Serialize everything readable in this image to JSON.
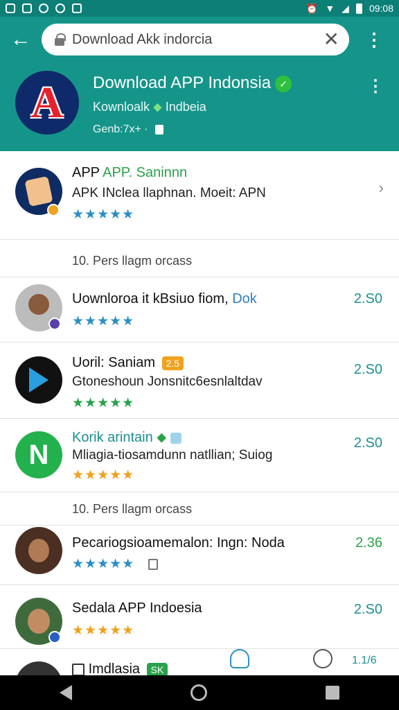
{
  "status_bar": {
    "time": "09:08"
  },
  "search": {
    "value": "Download Akk indorcia",
    "clear_glyph": "✕"
  },
  "header": {
    "title": "Download APP Indonsia",
    "verified_glyph": "✓",
    "subtitle": "Kownloalk",
    "subtitle_tag": "Indbeia",
    "meta": "Genb:7x+ ·",
    "logo_letter": "A"
  },
  "list": {
    "item1": {
      "title_a": "APP",
      "title_b": "APP. Saninnn",
      "sub": "APK INclea llaphnan. Moeit: APN",
      "stars": "★★★★★"
    },
    "section1": "10. Pers llagm orcass",
    "item2": {
      "title_a": "Uownloroa it kBsiuo fiom,",
      "title_b": "Dok",
      "stars": "★★★★★",
      "price": "2.S0"
    },
    "item3": {
      "title": "Uoril: Saniam",
      "chip": "2.5",
      "sub": "Gtoneshoun Jonsnitc6esnlaltdav",
      "stars": "★★★★★",
      "price": "2.S0"
    },
    "item4": {
      "title": "Korik arintain",
      "sub": "Mliagia-tiosamdunn natllian; Suiog",
      "stars": "★★★★★",
      "price": "2.S0"
    },
    "section2": "10. Pers llagm orcass",
    "item5": {
      "title": "Pecariogsioamemalon: Ingn: Noda",
      "stars": "★★★★★",
      "price": "2.36"
    },
    "item6": {
      "title": "Sedala APP Indoesia",
      "stars": "★★★★★",
      "price": "2.S0"
    },
    "item7": {
      "title": "Imdlasia",
      "chip": "SK",
      "price": "1.1/6"
    }
  },
  "colors": {
    "teal": "#15958a",
    "teal_dark": "#0c7f76",
    "star_blue": "#2a8fc7",
    "star_green": "#2aa14a",
    "star_orange": "#f0a21c",
    "star_gray": "#b5b5b5",
    "price_teal": "#1b8f93"
  }
}
